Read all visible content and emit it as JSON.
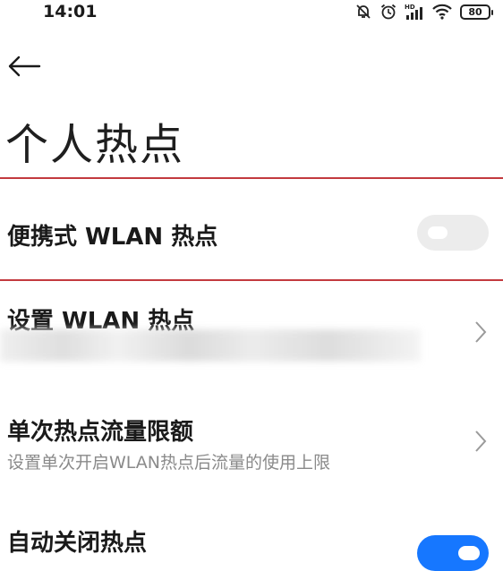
{
  "status_bar": {
    "time": "14:01",
    "icons": [
      "mute-bell-icon",
      "alarm-icon",
      "hd-signal-icon",
      "wifi-icon"
    ],
    "battery": "80"
  },
  "header": {
    "back_icon": "back-arrow-icon",
    "title": "个人热点"
  },
  "settings": {
    "portable_hotspot": {
      "label": "便携式 WLAN 热点",
      "toggle_on": false
    },
    "setup_hotspot": {
      "label": "设置 WLAN 热点"
    },
    "data_limit": {
      "label": "单次热点流量限额",
      "description": "设置单次开启WLAN热点后流量的使用上限"
    },
    "auto_close": {
      "label": "自动关闭热点",
      "toggle_on": true
    }
  },
  "colors": {
    "accent": "#1677ff",
    "highlight_border": "#c33a3f",
    "toggle_off": "#ececec",
    "subtext": "#8a8a8a"
  }
}
